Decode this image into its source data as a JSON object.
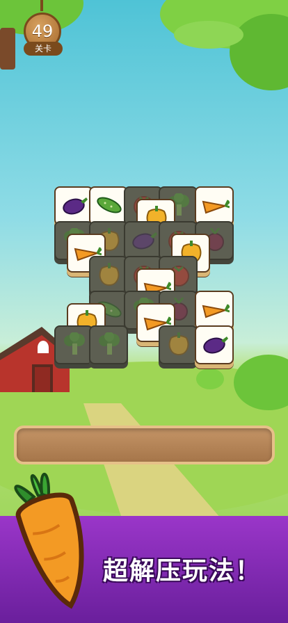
{
  "level": {
    "number": "49",
    "label": "关卡"
  },
  "slogan": "超解压玩法！",
  "colors": {
    "banner": "#7d28b0",
    "tray": "#b58356",
    "tile_front": "#fffdf4",
    "tile_back": "#5d5f52"
  },
  "tiles": [
    {
      "item": "eggplant-icon",
      "state": "active"
    },
    {
      "item": "cucumber-icon",
      "state": "active"
    },
    {
      "item": "tomato-icon",
      "state": "blocked"
    },
    {
      "item": "broccoli-icon",
      "state": "blocked"
    },
    {
      "item": "carrot-icon",
      "state": "active"
    },
    {
      "item": "pepper-icon",
      "state": "active"
    },
    {
      "item": "broccoli-icon",
      "state": "blocked"
    },
    {
      "item": "pepper-icon",
      "state": "blocked"
    },
    {
      "item": "eggplant-icon",
      "state": "blocked"
    },
    {
      "item": "tomato-icon",
      "state": "blocked"
    },
    {
      "item": "beet-icon",
      "state": "blocked"
    },
    {
      "item": "carrot-icon",
      "state": "active"
    },
    {
      "item": "pepper-icon",
      "state": "active"
    },
    {
      "item": "pepper-icon",
      "state": "blocked"
    },
    {
      "item": "tomato-icon",
      "state": "blocked"
    },
    {
      "item": "tomato-icon",
      "state": "blocked"
    },
    {
      "item": "carrot-icon",
      "state": "active"
    },
    {
      "item": "cucumber-icon",
      "state": "blocked"
    },
    {
      "item": "broccoli-icon",
      "state": "blocked"
    },
    {
      "item": "beet-icon",
      "state": "blocked"
    },
    {
      "item": "carrot-icon",
      "state": "active"
    },
    {
      "item": "pepper-icon",
      "state": "active"
    },
    {
      "item": "carrot-icon",
      "state": "active"
    },
    {
      "item": "broccoli-icon",
      "state": "blocked"
    },
    {
      "item": "broccoli-icon",
      "state": "blocked"
    },
    {
      "item": "pepper-icon",
      "state": "blocked"
    },
    {
      "item": "eggplant-icon",
      "state": "active"
    }
  ]
}
